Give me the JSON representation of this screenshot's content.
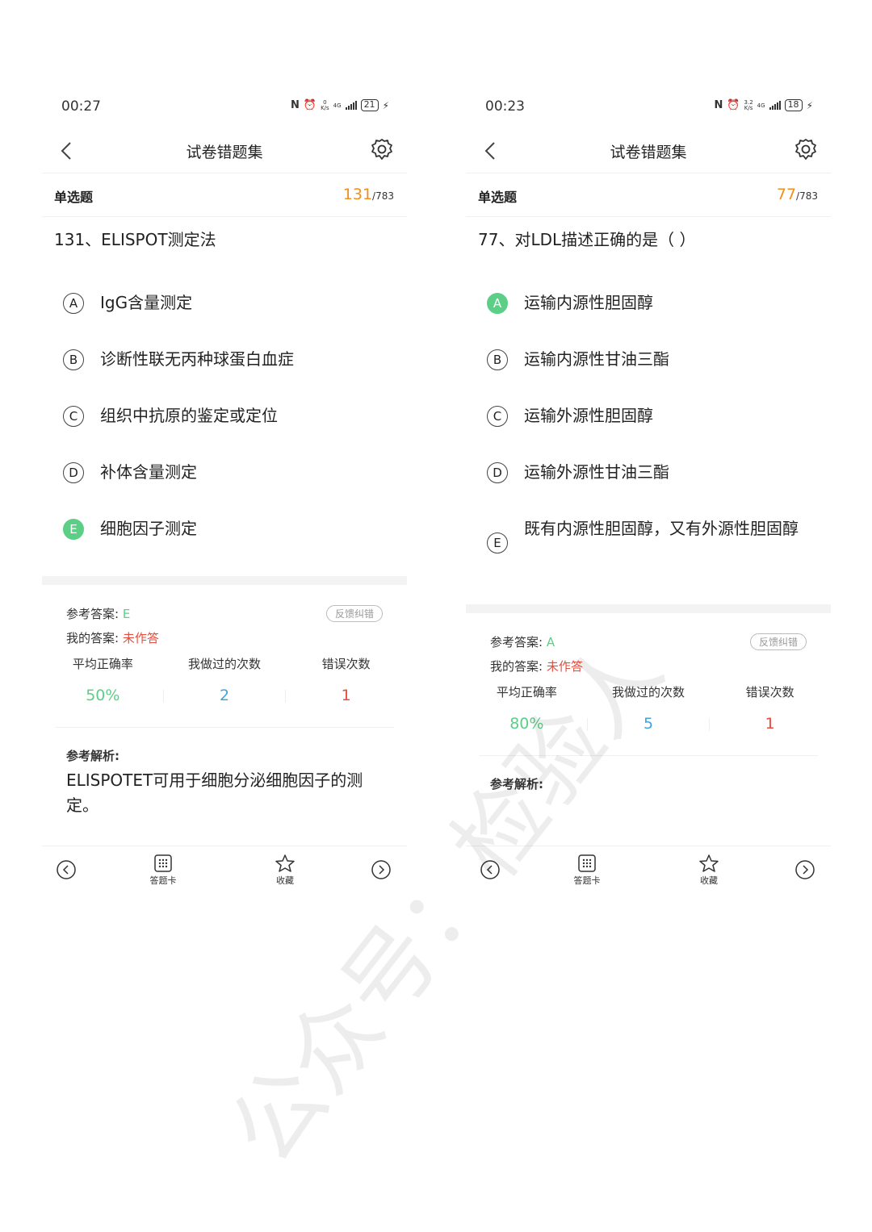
{
  "screens": [
    {
      "status": {
        "time": "00:27",
        "speed_top": "0",
        "speed_bottom": "K/s",
        "network": "4G",
        "battery": "21"
      },
      "title": "试卷错题集",
      "question_type": "单选题",
      "progress_current": "131",
      "progress_total": "/783",
      "question": "131、ELISPOT测定法",
      "options": [
        {
          "letter": "A",
          "text": "IgG含量测定"
        },
        {
          "letter": "B",
          "text": "诊断性联无丙种球蛋白血症"
        },
        {
          "letter": "C",
          "text": "组织中抗原的鉴定或定位"
        },
        {
          "letter": "D",
          "text": "补体含量测定"
        },
        {
          "letter": "E",
          "text": "细胞因子测定"
        }
      ],
      "correct_option": "E",
      "ref_answer_label": "参考答案:",
      "ref_answer_value": "E",
      "my_answer_label": "我的答案:",
      "my_answer_value": "未作答",
      "feedback_label": "反馈纠错",
      "stats_headers": [
        "平均正确率",
        "我做过的次数",
        "错误次数"
      ],
      "stats_values": [
        "50%",
        "2",
        "1"
      ],
      "analysis_label": "参考解析:",
      "analysis_text": "ELISPOTET可用于细胞分泌细胞因子的测定。",
      "bottom": {
        "card_label": "答题卡",
        "fav_label": "收藏"
      }
    },
    {
      "status": {
        "time": "00:23",
        "speed_top": "3.2",
        "speed_bottom": "K/s",
        "network": "4G",
        "battery": "18"
      },
      "title": "试卷错题集",
      "question_type": "单选题",
      "progress_current": "77",
      "progress_total": "/783",
      "question": "77、对LDL描述正确的是（   ）",
      "options": [
        {
          "letter": "A",
          "text": "运输内源性胆固醇"
        },
        {
          "letter": "B",
          "text": "运输内源性甘油三酯"
        },
        {
          "letter": "C",
          "text": "运输外源性胆固醇"
        },
        {
          "letter": "D",
          "text": "运输外源性甘油三酯"
        },
        {
          "letter": "E",
          "text": "既有内源性胆固醇，又有外源性胆固醇"
        }
      ],
      "correct_option": "A",
      "ref_answer_label": "参考答案:",
      "ref_answer_value": "A",
      "my_answer_label": "我的答案:",
      "my_answer_value": "未作答",
      "feedback_label": "反馈纠错",
      "stats_headers": [
        "平均正确率",
        "我做过的次数",
        "错误次数"
      ],
      "stats_values": [
        "80%",
        "5",
        "1"
      ],
      "analysis_label": "参考解析:",
      "analysis_text": "",
      "bottom": {
        "card_label": "答题卡",
        "fav_label": "收藏"
      }
    }
  ],
  "watermark": "公众号：检验人",
  "colors": {
    "correct": "#5ccf87",
    "accent_orange": "#f0901a",
    "red": "#e74c3c",
    "blue": "#3ea6dc"
  }
}
